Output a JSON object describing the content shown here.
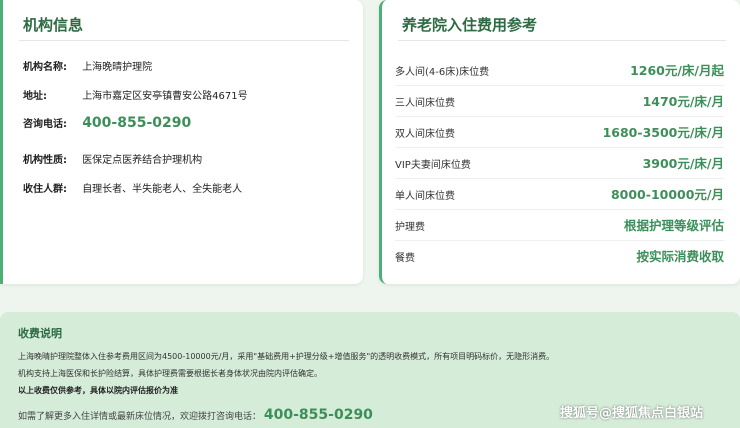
{
  "info": {
    "title": "机构信息",
    "rows": [
      {
        "label": "机构名称:",
        "value": "上海晚晴护理院"
      },
      {
        "label": "地址:",
        "value": "上海市嘉定区安亭镇曹安公路4671号"
      },
      {
        "label": "咨询电话:",
        "value": "400-855-0290"
      },
      {
        "label": "机构性质:",
        "value": "医保定点医养结合护理机构"
      },
      {
        "label": "收住人群:",
        "value": "自理长者、半失能老人、全失能老人"
      }
    ]
  },
  "fees": {
    "title": "养老院入住费用参考",
    "rows": [
      {
        "label": "多人间(4-6床)床位费",
        "value": "1260元/床/月起"
      },
      {
        "label": "三人间床位费",
        "value": "1470元/床/月"
      },
      {
        "label": "双人间床位费",
        "value": "1680-3500元/床/月"
      },
      {
        "label": "VIP夫妻间床位费",
        "value": "3900元/床/月"
      },
      {
        "label": "单人间床位费",
        "value": "8000-10000元/月"
      },
      {
        "label": "护理费",
        "value": "根据护理等级评估"
      },
      {
        "label": "餐费",
        "value": "按实际消费收取"
      }
    ]
  },
  "note": {
    "title": "收费说明",
    "line1": "上海晚晴护理院整体入住参考费用区间为4500-10000元/月，采用\"基础费用+护理分级+增值服务\"的透明收费模式，所有项目明码标价，无隐形消费。",
    "line2": "机构支持上海医保和长护险结算，具体护理费需要根据长者身体状况由院内评估确定。",
    "line3": "以上收费仅供参考，具体以院内评估报价为准",
    "contact_prefix": "如需了解更多入住详情或最新床位情况，欢迎拨打咨询电话：",
    "contact_phone": "400-855-0290"
  },
  "watermark": "搜狐号@搜狐焦点白银站",
  "colors": {
    "accent": "#3d8f5a",
    "title": "#2e6b43",
    "note_bg": "#d4ecd8"
  }
}
